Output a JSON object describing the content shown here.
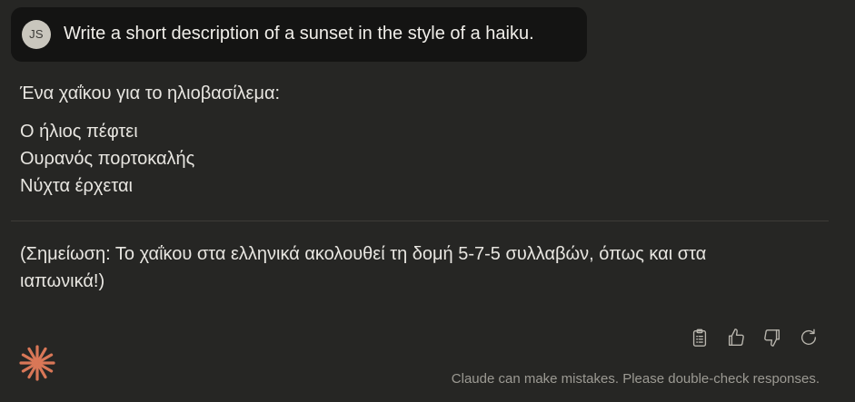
{
  "user_message": {
    "avatar_initials": "JS",
    "text": "Write a short description of a sunset in the style of a haiku."
  },
  "response": {
    "intro": "Ένα χαΐκου για το ηλιοβασίλεμα:",
    "haiku": [
      "Ο ήλιος πέφτει",
      "Ουρανός πορτοκαλής",
      "Νύχτα έρχεται"
    ],
    "note": "(Σημείωση: Το χαΐκου στα ελληνικά ακολουθεί τη δομή 5-7-5 συλλαβών, όπως και στα ιαπωνικά!)"
  },
  "actions": {
    "icons": [
      "clipboard-icon",
      "thumbs-up-icon",
      "thumbs-down-icon",
      "retry-icon"
    ]
  },
  "footer": {
    "disclaimer": "Claude can make mistakes. Please double-check responses."
  },
  "colors": {
    "background": "#262624",
    "user_bubble": "#141413",
    "avatar": "#c9c6bd",
    "brand_accent": "#d97757",
    "muted_text": "#9c9a93"
  }
}
